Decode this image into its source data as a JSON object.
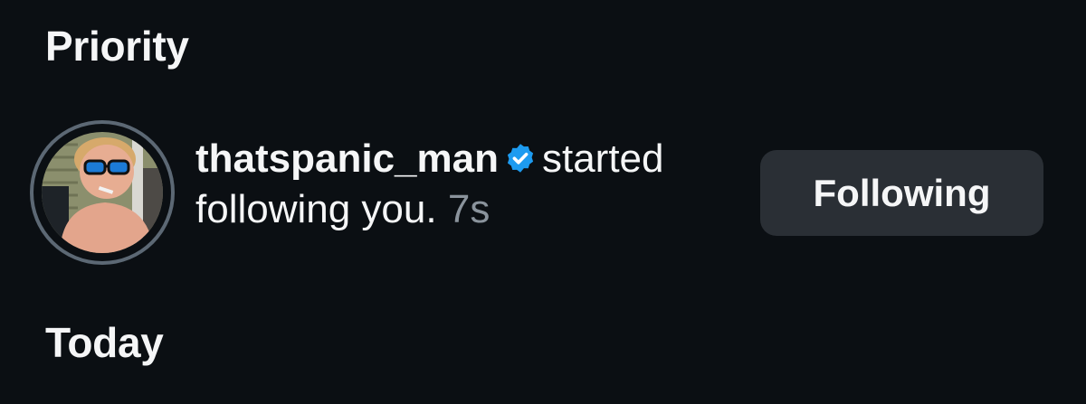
{
  "sections": {
    "priority_title": "Priority",
    "today_title": "Today"
  },
  "notification": {
    "username": "thatspanic_man",
    "verified_icon": "verified-badge-icon",
    "action_part1": "started",
    "action_part2": "following you.",
    "time": "7s",
    "button_label": "Following"
  },
  "colors": {
    "background": "#0b0f13",
    "text": "#f5f6f7",
    "muted_text": "#8a939c",
    "button_bg": "#2a2f35",
    "verified_blue": "#1d9bf0",
    "story_ring": "#5c6874"
  }
}
